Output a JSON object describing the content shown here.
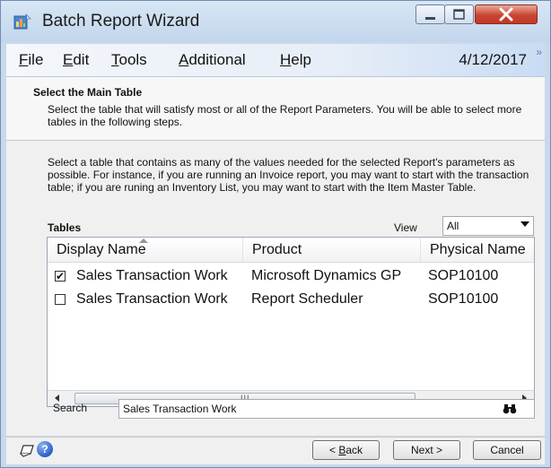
{
  "window": {
    "title": "Batch Report Wizard"
  },
  "menu": {
    "file_pre": "",
    "file_key": "F",
    "file_post": "ile",
    "edit_pre": "",
    "edit_key": "E",
    "edit_post": "dit",
    "tools_pre": "",
    "tools_key": "T",
    "tools_post": "ools",
    "additional_pre": "",
    "additional_key": "A",
    "additional_post": "dditional",
    "help_pre": "",
    "help_key": "H",
    "help_post": "elp",
    "date": "4/12/2017",
    "overflow": "»"
  },
  "header": {
    "title": "Select the Main Table",
    "description": "Select the table that will satisfy most or all of the Report Parameters.  You will be able to select more tables in the following steps."
  },
  "intro": "Select a table that contains as many of the values needed for the selected Report's parameters as possible.  For instance, if you are running an Invoice report, you may want to start with the transaction table; if you are runing an Inventory List, you may want to start with the Item Master Table.",
  "tables": {
    "label": "Tables",
    "view_label": "View",
    "view_value": "All",
    "columns": [
      "Display Name",
      "Product",
      "Physical Name"
    ],
    "rows": [
      {
        "checked": true,
        "check_glyph": "✔",
        "display": "Sales Transaction Work",
        "product": "Microsoft Dynamics GP",
        "physical": "SOP10100"
      },
      {
        "checked": false,
        "check_glyph": "",
        "display": "Sales Transaction Work",
        "product": "Report Scheduler",
        "physical": "SOP10100"
      }
    ],
    "scroll_grip": "III"
  },
  "search": {
    "label": "Search",
    "value": "Sales Transaction Work"
  },
  "buttons": {
    "back_pre": "< ",
    "back_key": "B",
    "back_post": "ack",
    "next": "Next >",
    "cancel": "Cancel"
  },
  "colors": {
    "accent": "#2a5fc9",
    "menu_gradient_end": "#c9dcf4"
  }
}
